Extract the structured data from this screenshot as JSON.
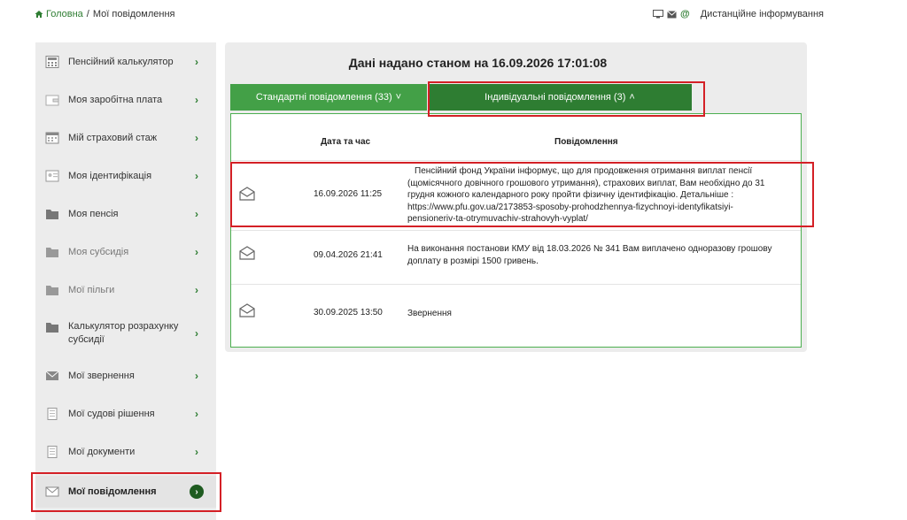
{
  "breadcrumb": {
    "home_label": "Головна",
    "separator": "/",
    "current": "Мої повідомлення"
  },
  "topright": {
    "label": "Дистанційне інформування"
  },
  "sidebar": {
    "items": [
      {
        "label": "Пенсійний калькулятор",
        "icon": "calculator-icon"
      },
      {
        "label": "Моя заробітна плата",
        "icon": "wallet-icon"
      },
      {
        "label": "Мій страховий стаж",
        "icon": "calendar-icon"
      },
      {
        "label": "Моя ідентифікація",
        "icon": "id-card-icon"
      },
      {
        "label": "Моя пенсія",
        "icon": "folder-icon"
      },
      {
        "label": "Моя субсидія",
        "icon": "folder-icon"
      },
      {
        "label": "Мої пільги",
        "icon": "folder-icon"
      },
      {
        "label": "Калькулятор розрахунку субсидії",
        "icon": "folder-icon"
      },
      {
        "label": "Мої звернення",
        "icon": "mail-icon"
      },
      {
        "label": "Мої судові рішення",
        "icon": "document-icon"
      },
      {
        "label": "Мої документи",
        "icon": "document-icon"
      },
      {
        "label": "Мої повідомлення",
        "icon": "mail-icon"
      }
    ]
  },
  "main": {
    "title": "Дані надано станом на 16.09.2026 17:01:08",
    "tabs": [
      {
        "label": "Стандартні повідомлення (33)",
        "chevron": "˅"
      },
      {
        "label": "Індивідуальні повідомлення (3)",
        "chevron": "˄"
      }
    ],
    "table": {
      "headers": [
        "Дата та час",
        "Повідомлення"
      ],
      "rows": [
        {
          "datetime": "16.09.2026 11:25",
          "message": "Пенсійний фонд України інформує, що для продовження отримання виплат пенсії (щомісячного довічного грошового утримання), страхових виплат, Вам необхідно до 31 грудня кожного календарного року пройти фізичну ідентифікацію. Детальніше : https://www.pfu.gov.ua/2173853-sposoby-prohodzhennya-fizychnoyi-identyfikatsiyi-pensioneriv-ta-otrymuvachiv-strahovyh-vyplat/"
        },
        {
          "datetime": "09.04.2026 21:41",
          "message": "На виконання постанови КМУ від 18.03.2026 № 341 Вам виплачено одноразову грошову доплату в розмірі 1500 гривень."
        },
        {
          "datetime": "30.09.2025 13:50",
          "message": "Звернення"
        }
      ]
    }
  },
  "colors": {
    "accent_green": "#2e7d32",
    "tab_green": "#43a047",
    "highlight_red": "#d42026"
  }
}
